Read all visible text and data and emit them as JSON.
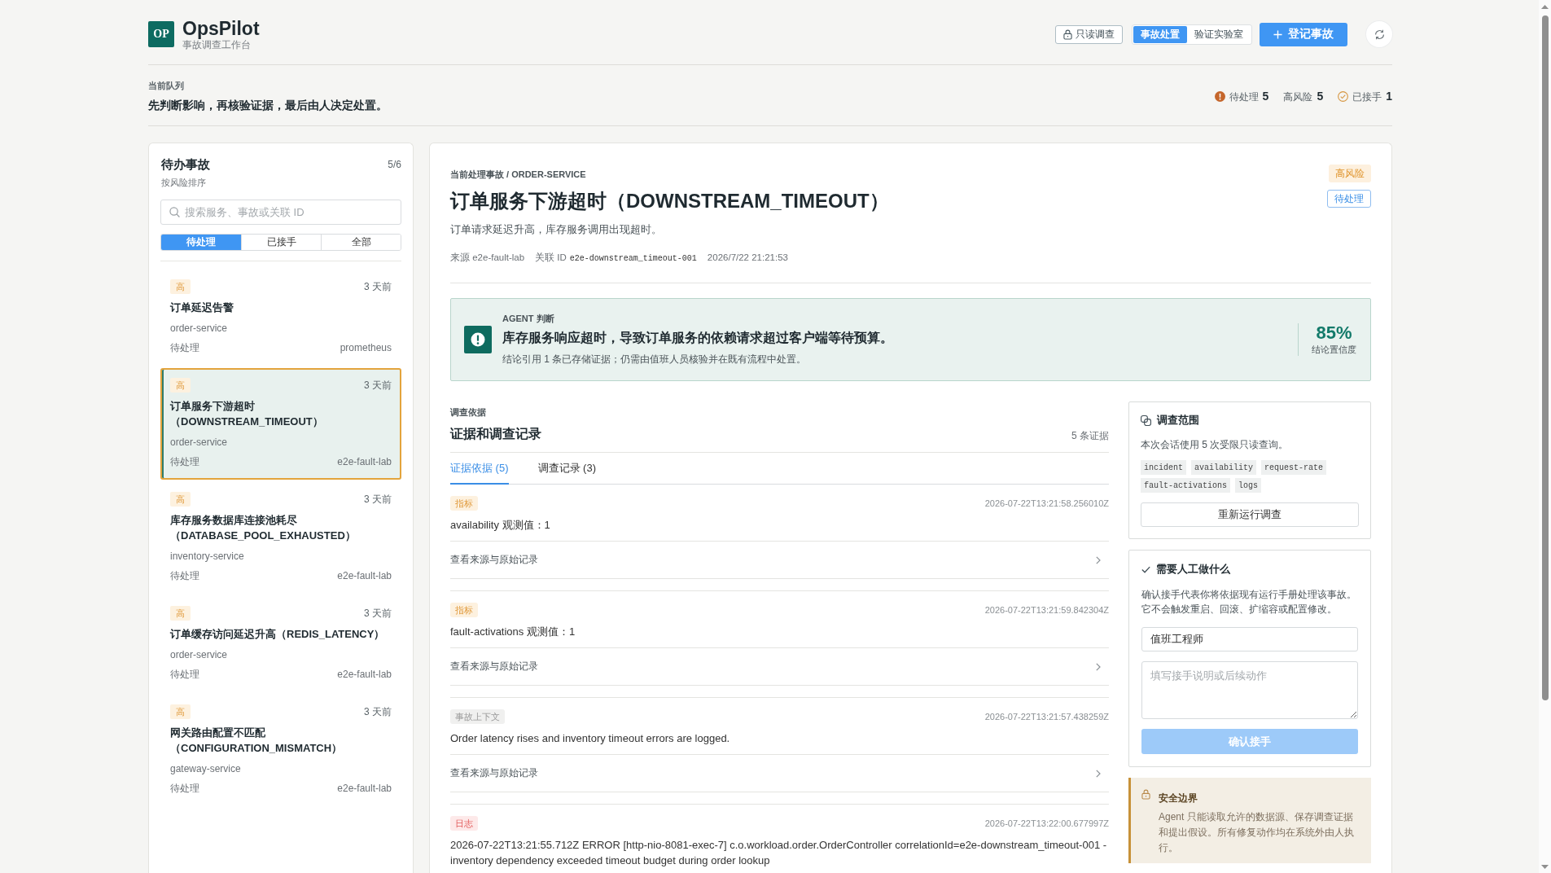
{
  "header": {
    "logo": "OP",
    "app_name": "OpsPilot",
    "app_subtitle": "事故调查工作台",
    "readonly_button": "只读调查",
    "modes": [
      {
        "label": "事故处置",
        "selected": true
      },
      {
        "label": "验证实验室",
        "selected": false
      }
    ],
    "primary_button": "登记事故"
  },
  "queue": {
    "label": "当前队列",
    "summary": "先判断影响，再核验证据，最后由人决定处置。",
    "stats": [
      {
        "kind": "alert",
        "label": "待处理",
        "value": "5"
      },
      {
        "kind": "plain",
        "label": "高风险",
        "value": "5"
      },
      {
        "kind": "done",
        "label": "已接手",
        "value": "1"
      }
    ]
  },
  "incident_list": {
    "title": "待办事故",
    "count": "5/6",
    "subtitle": "按风险排序",
    "search": {
      "placeholder": "搜索服务、事故或关联 ID"
    },
    "filters": [
      {
        "label": "待处理",
        "selected": true
      },
      {
        "label": "已接手",
        "selected": false
      },
      {
        "label": "全部",
        "selected": false
      }
    ],
    "items": [
      {
        "severity": "高",
        "age": "3 天前",
        "title": "订单延迟告警",
        "service": "order-service",
        "status": "待处理",
        "source": "prometheus",
        "selected": false
      },
      {
        "severity": "高",
        "age": "3 天前",
        "title": "订单服务下游超时（DOWNSTREAM_TIMEOUT）",
        "service": "order-service",
        "status": "待处理",
        "source": "e2e-fault-lab",
        "selected": true
      },
      {
        "severity": "高",
        "age": "3 天前",
        "title": "库存服务数据库连接池耗尽（DATABASE_POOL_EXHAUSTED）",
        "service": "inventory-service",
        "status": "待处理",
        "source": "e2e-fault-lab",
        "selected": false
      },
      {
        "severity": "高",
        "age": "3 天前",
        "title": "订单缓存访问延迟升高（REDIS_LATENCY）",
        "service": "order-service",
        "status": "待处理",
        "source": "e2e-fault-lab",
        "selected": false
      },
      {
        "severity": "高",
        "age": "3 天前",
        "title": "网关路由配置不匹配（CONFIGURATION_MISMATCH）",
        "service": "gateway-service",
        "status": "待处理",
        "source": "e2e-fault-lab",
        "selected": false
      }
    ]
  },
  "incident": {
    "breadcrumb": "当前处理事故 / ORDER-SERVICE",
    "title": "订单服务下游超时（DOWNSTREAM_TIMEOUT）",
    "description": "订单请求延迟升高，库存服务调用出现超时。",
    "meta": [
      {
        "kind": "text",
        "text": "来源 e2e-fault-lab"
      },
      {
        "kind": "id",
        "label": "关联 ID",
        "value": "e2e-downstream_timeout-001"
      },
      {
        "kind": "text",
        "text": "2026/7/22 21:21:53"
      }
    ],
    "badges": [
      {
        "kind": "risk",
        "label": "高风险"
      },
      {
        "kind": "status",
        "label": "待处理"
      }
    ]
  },
  "agent_verdict": {
    "label": "AGENT 判断",
    "conclusion": "库存服务响应超时，导致订单服务的依赖请求超过客户端等待预算。",
    "note": "结论引用 1 条已存储证据；仍需由值班人员核验并在既有流程中处置。",
    "confidence": "85%",
    "confidence_label": "结论置信度"
  },
  "evidence": {
    "eyebrow": "调查依据",
    "title": "证据和调查记录",
    "count": "5 条证据",
    "tabs": [
      {
        "label": "证据依据 (5)",
        "selected": true
      },
      {
        "label": "调查记录 (3)",
        "selected": false
      }
    ],
    "items": [
      {
        "kind": "metric",
        "tag": "指标",
        "time": "2026-07-22T13:21:58.256010Z",
        "text": "availability 观测值：1",
        "link": "查看来源与原始记录"
      },
      {
        "kind": "metric",
        "tag": "指标",
        "time": "2026-07-22T13:21:59.842304Z",
        "text": "fault-activations 观测值：1",
        "link": "查看来源与原始记录"
      },
      {
        "kind": "context",
        "tag": "事故上下文",
        "time": "2026-07-22T13:21:57.438259Z",
        "text": "Order latency rises and inventory timeout errors are logged.",
        "link": "查看来源与原始记录"
      },
      {
        "kind": "log",
        "tag": "日志",
        "time": "2026-07-22T13:22:00.677997Z",
        "text": "2026-07-22T13:21:55.712Z ERROR [http-nio-8081-exec-7] c.o.workload.order.OrderController correlationId=e2e-downstream_timeout-001 - inventory dependency exceeded timeout budget during order lookup"
      }
    ]
  },
  "scope": {
    "title": "调查范围",
    "description": "本次会话使用 5 次受限只读查询。",
    "tags": [
      "incident",
      "availability",
      "request-rate",
      "fault-activations",
      "logs"
    ],
    "button": "重新运行调查"
  },
  "handoff": {
    "title": "需要人工做什么",
    "description": "确认接手代表你将依据现有运行手册处理该事故。它不会触发重启、回滚、扩缩容或配置修改。",
    "assignee": {
      "value": "值班工程师"
    },
    "note": {
      "placeholder": "填写接手说明或后续动作"
    },
    "confirm_button": {
      "label": "确认接手",
      "disabled": true
    }
  },
  "safety": {
    "title": "安全边界",
    "text": "Agent 只能读取允许的数据源、保存调查证据和提出假设。所有修复动作均在系统外由人执行。"
  }
}
